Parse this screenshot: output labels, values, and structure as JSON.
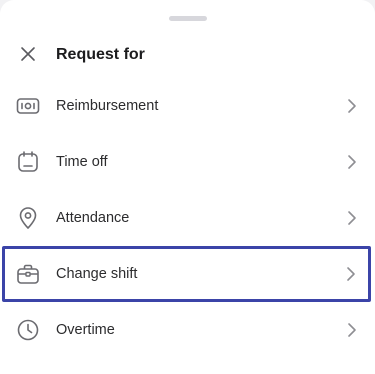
{
  "sheet": {
    "title": "Request for",
    "close_icon": "close-icon"
  },
  "items": [
    {
      "label": "Reimbursement",
      "icon": "banknote-icon",
      "highlighted": false
    },
    {
      "label": "Time off",
      "icon": "calendar-icon",
      "highlighted": false
    },
    {
      "label": "Attendance",
      "icon": "location-pin-icon",
      "highlighted": false
    },
    {
      "label": "Change shift",
      "icon": "briefcase-icon",
      "highlighted": true
    },
    {
      "label": "Overtime",
      "icon": "clock-icon",
      "highlighted": false
    }
  ],
  "colors": {
    "highlight_border": "#3b44a8",
    "icon_stroke": "#6b6b70",
    "text": "#2c2c2e",
    "chevron": "#8e8e93"
  }
}
